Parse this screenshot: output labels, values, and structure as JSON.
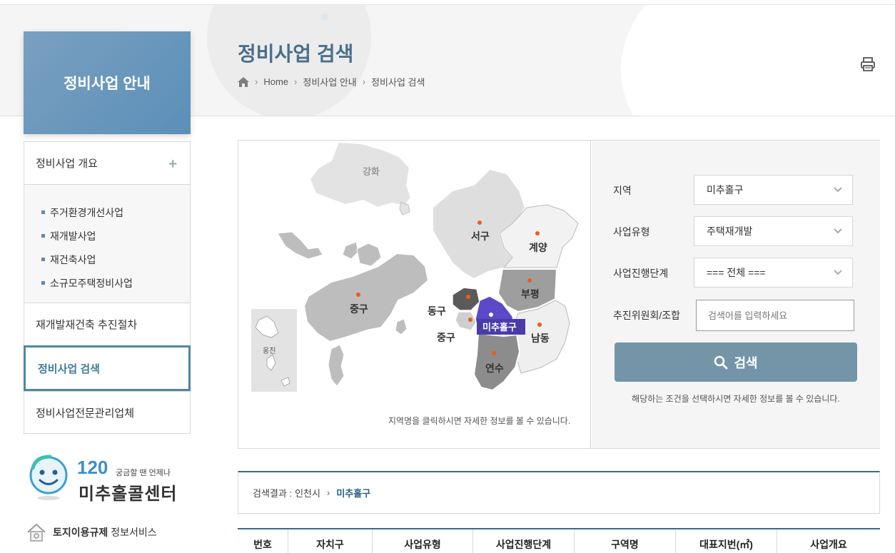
{
  "header": {
    "section_title": "정비사업 안내",
    "page_title": "정비사업 검색",
    "breadcrumb": [
      "Home",
      "정비사업 안내",
      "정비사업 검색"
    ]
  },
  "sidebar": {
    "items": [
      {
        "label": "정비사업 개요"
      },
      {
        "label": "재개발재건축 추진절차"
      },
      {
        "label": "정비사업 검색"
      },
      {
        "label": "정비사업전문관리업체"
      }
    ],
    "submenu": [
      "주거환경개선사업",
      "재개발사업",
      "재건축사업",
      "소규모주택정비사업"
    ]
  },
  "callcenter": {
    "number": "120",
    "tagline": "궁금할 땐 언제나",
    "name": "미추홀콜센터"
  },
  "land_service": {
    "bold": "토지이용규제",
    "rest": "정보서비스"
  },
  "map": {
    "regions": [
      "강화",
      "서구",
      "계양",
      "부평",
      "중구",
      "동구",
      "중구",
      "미추홀구",
      "남동",
      "연수",
      "옹진"
    ],
    "selected_region": "미추홀구",
    "note": "지역명을 클릭하시면 자세한 정보를 볼 수 있습니다."
  },
  "search": {
    "region_label": "지역",
    "region_value": "미추홀구",
    "type_label": "사업유형",
    "type_value": "주택재개발",
    "stage_label": "사업진행단계",
    "stage_value": "=== 전체 ===",
    "committee_label": "추진위원회/조합",
    "committee_placeholder": "검색어를 입력하세요",
    "button_label": "검색",
    "help": "해당하는 조건을 선택하시면 자세한 정보를 볼 수 있습니다."
  },
  "result": {
    "prefix": "검색결과 :",
    "city": "인천시",
    "district": "미추홀구"
  },
  "table": {
    "columns": [
      "번호",
      "자치구",
      "사업유형",
      "사업진행단계",
      "구역명",
      "대표지번(㎡)",
      "사업개요"
    ]
  },
  "colors": {
    "accent": "#4f86a3",
    "title": "#4a6f8a",
    "selected_region": "#5b49c8",
    "button": "#7495a8"
  }
}
